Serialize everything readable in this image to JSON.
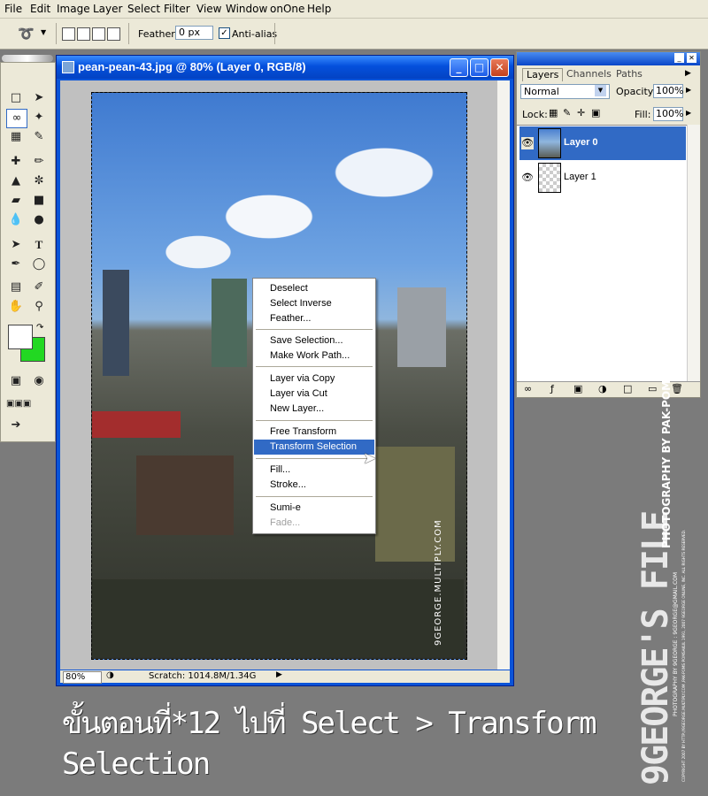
{
  "menu": [
    "File",
    "Edit",
    "Image",
    "Layer",
    "Select",
    "Filter",
    "View",
    "Window",
    "onOne",
    "Help"
  ],
  "options": {
    "feather_label": "Feather:",
    "feather_value": "0 px",
    "antialias_label": "Anti-alias"
  },
  "document": {
    "title": "pean-pean-43.jpg @ 80% (Layer 0, RGB/8)",
    "zoom": "80%",
    "scratch": "Scratch: 1014.8M/1.34G",
    "watermark": "9GEORGE.MULTIPLY.COM"
  },
  "context_menu": {
    "groups": [
      [
        "Deselect",
        "Select Inverse",
        "Feather..."
      ],
      [
        "Save Selection...",
        "Make Work Path..."
      ],
      [
        "Layer via Copy",
        "Layer via Cut",
        "New Layer..."
      ],
      [
        "Free Transform",
        "Transform Selection"
      ],
      [
        "Fill...",
        "Stroke..."
      ],
      [
        "Sumi-e",
        "Fade..."
      ]
    ],
    "selected": "Transform Selection",
    "disabled": [
      "Fade..."
    ]
  },
  "layers_panel": {
    "tabs": [
      "Layers",
      "Channels",
      "Paths"
    ],
    "blend_mode": "Normal",
    "opacity_label": "Opacity:",
    "opacity_value": "100%",
    "lock_label": "Lock:",
    "fill_label": "Fill:",
    "fill_value": "100%",
    "layers": [
      {
        "name": "Layer 0",
        "selected": true
      },
      {
        "name": "Layer 1",
        "selected": false
      }
    ]
  },
  "caption": "ขั้นตอนที่*12 ไปที่ Select > Transform Selection",
  "branding": {
    "logo": "9GEORGE'S FILE",
    "credit1": "PHOTOGRAPHY BY PAK-POMS",
    "credit2": "PHOTOGRAPHY BY 9GEORGE : 9GEORGE@GMAIL.COM",
    "credit3": "COPYRIGHT 2007 BY HTTP://9GEORGE.MULTIPLY.COM ,PAK-POMS POMSAKUL 1991, 2007 9GEORGE ONLINE, INC. ALL RIGHTS RESERVED."
  },
  "colors": {
    "accent": "#316ac5",
    "titlebar": "#0a54d8",
    "background_swatch": "#22d822",
    "foreground_swatch": "#ffffff"
  }
}
